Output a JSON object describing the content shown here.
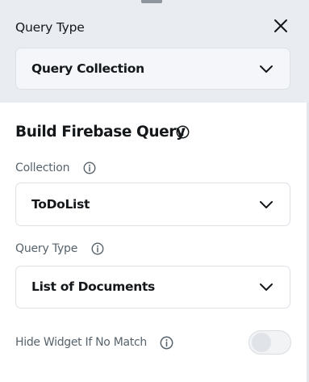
{
  "query_type_section": {
    "label": "Query Type",
    "selected": "Query Collection"
  },
  "firebase_query": {
    "title": "Build Firebase Query",
    "collection": {
      "label": "Collection",
      "selected": "ToDoList"
    },
    "query_type": {
      "label": "Query Type",
      "selected": "List of Documents"
    },
    "hide_widget": {
      "label": "Hide Widget If No Match",
      "enabled": false
    }
  },
  "icons": {
    "close": "close-icon",
    "chevron": "chevron-down-icon",
    "info": "info-icon"
  },
  "colors": {
    "top_background": "#e9ecf1",
    "text_primary": "#14181b",
    "text_secondary": "#57636c",
    "border": "#dde1e6"
  }
}
